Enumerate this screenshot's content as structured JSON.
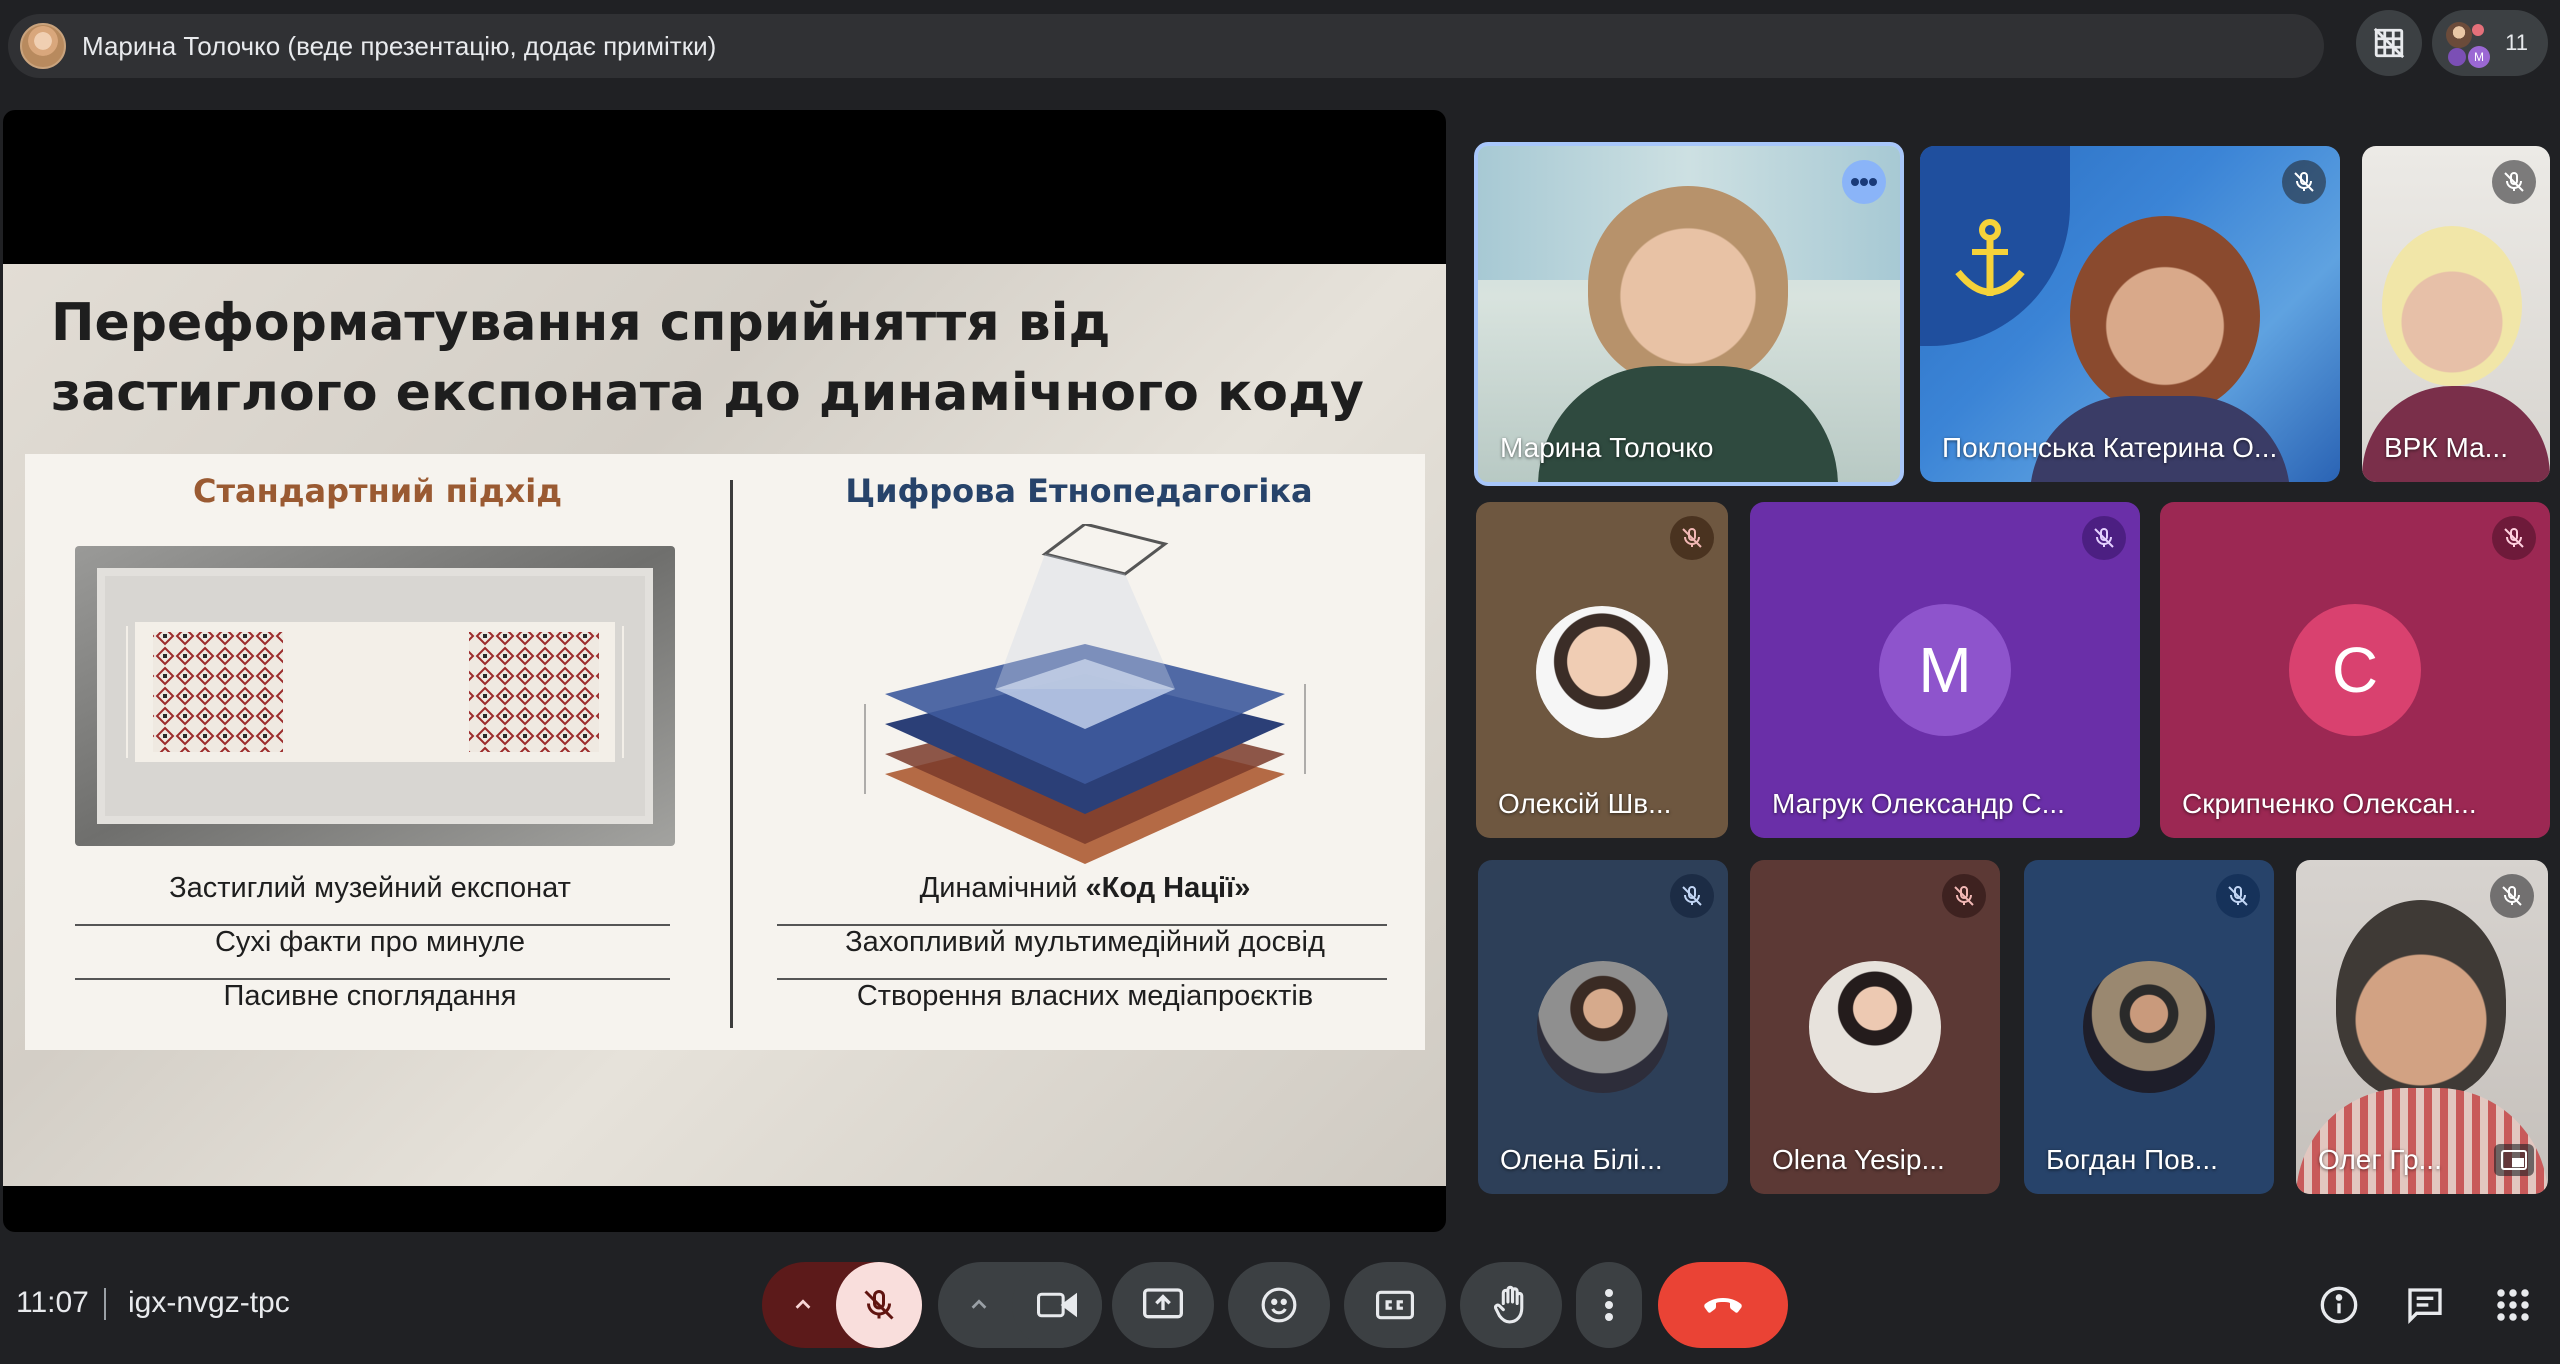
{
  "topbar": {
    "presenter_text": "Марина Толочко (веде презентацію, додає примітки)",
    "participant_count": "11"
  },
  "slide": {
    "title": "Переформатування сприйняття від застиглого експоната до динамічного коду",
    "left_heading": "Стандартний підхід",
    "right_heading": "Цифрова Етнопедагогіка",
    "left_rows": [
      "Застиглий музейний експонат",
      "Сухі факти про минуле",
      "Пасивне споглядання"
    ],
    "right_row1_prefix": "Динамічний ",
    "right_row1_bold": "«Код Нації»",
    "right_rows": [
      "Захопливий мультимедійний досвід",
      "Створення власних медіапроєктів"
    ]
  },
  "tiles": [
    {
      "name": "Марина Толочко"
    },
    {
      "name": "Поклонська Катерина О..."
    },
    {
      "name": "ВРК Ма..."
    },
    {
      "name": "Олексій Шв..."
    },
    {
      "name": "Магрук Олександр С...",
      "letter": "M"
    },
    {
      "name": "Скрипченко Олексан...",
      "letter": "C"
    },
    {
      "name": "Олена Білі..."
    },
    {
      "name": "Olena Yesip..."
    },
    {
      "name": "Богдан Пов..."
    },
    {
      "name": "Олег Гр..."
    }
  ],
  "bottombar": {
    "time": "11:07",
    "meeting_code": "igx-nvgz-tpc"
  },
  "colors": {
    "background": "#202124",
    "end_call": "#ea4335",
    "mic_off_active": "#f9dedc",
    "accent_purple": "#7b3fbf",
    "accent_pink": "#d9416f"
  }
}
